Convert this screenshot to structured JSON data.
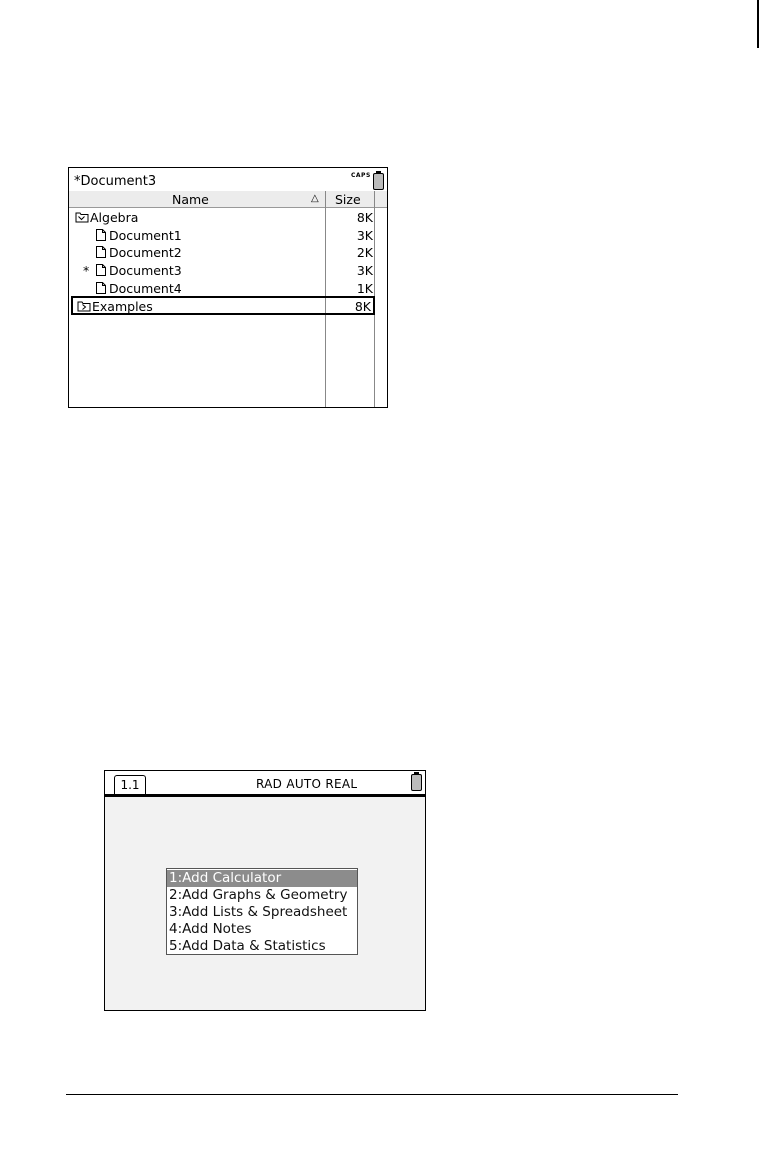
{
  "file_browser": {
    "title": "*Document3",
    "caps_indicator": "CAPS",
    "columns": {
      "name": "Name",
      "size": "Size"
    },
    "rows": [
      {
        "name": "Algebra",
        "size": "8K",
        "type": "folder-open",
        "indent": 0,
        "modified": false,
        "selected": false
      },
      {
        "name": "Document1",
        "size": "3K",
        "type": "document",
        "indent": 1,
        "modified": false,
        "selected": false
      },
      {
        "name": "Document2",
        "size": "2K",
        "type": "document",
        "indent": 1,
        "modified": false,
        "selected": false
      },
      {
        "name": "Document3",
        "size": "3K",
        "type": "document",
        "indent": 1,
        "modified": true,
        "marker": "*",
        "selected": false
      },
      {
        "name": "Document4",
        "size": "1K",
        "type": "document",
        "indent": 1,
        "modified": false,
        "selected": false
      },
      {
        "name": "Examples",
        "size": "8K",
        "type": "folder-closed",
        "indent": 0,
        "modified": false,
        "selected": true
      }
    ]
  },
  "document_screen": {
    "tab_label": "1.1",
    "mode_status": "RAD AUTO REAL",
    "menu": [
      {
        "num": "1:",
        "label": "Add Calculator",
        "highlighted": true
      },
      {
        "num": "2:",
        "label": "Add Graphs & Geometry",
        "highlighted": false
      },
      {
        "num": "3:",
        "label": "Add Lists & Spreadsheet",
        "highlighted": false
      },
      {
        "num": "4:",
        "label": "Add Notes",
        "highlighted": false
      },
      {
        "num": "5:",
        "label": "Add Data & Statistics",
        "highlighted": false
      }
    ]
  },
  "colors": {
    "menu_highlight": "#8c8c8c",
    "screen_background": "#f2f2f2",
    "header_background": "#ececec"
  }
}
